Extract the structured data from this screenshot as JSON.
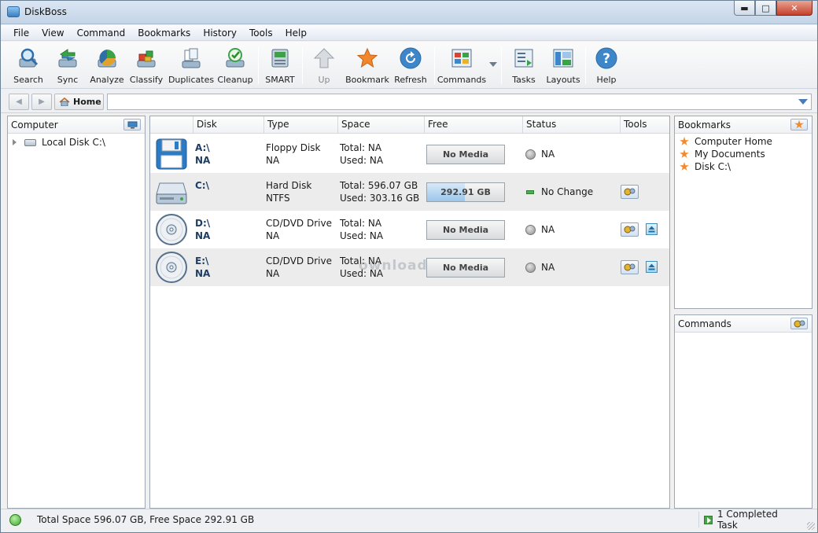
{
  "window": {
    "title": "DiskBoss",
    "minimize": "▬",
    "maximize": "□",
    "close": "✕"
  },
  "menu": [
    "File",
    "View",
    "Command",
    "Bookmarks",
    "History",
    "Tools",
    "Help"
  ],
  "toolbar": {
    "search": "Search",
    "sync": "Sync",
    "analyze": "Analyze",
    "classify": "Classify",
    "duplicates": "Duplicates",
    "cleanup": "Cleanup",
    "smart": "SMART",
    "up": "Up",
    "bookmark": "Bookmark",
    "refresh": "Refresh",
    "commands": "Commands",
    "tasks": "Tasks",
    "layouts": "Layouts",
    "help": "Help"
  },
  "nav": {
    "home_label": "Home",
    "address_value": ""
  },
  "left_panel": {
    "title": "Computer",
    "tree": [
      {
        "label": "Local Disk C:\\"
      }
    ]
  },
  "columns": {
    "disk": "Disk",
    "type": "Type",
    "space": "Space",
    "free": "Free",
    "status": "Status",
    "tools": "Tools"
  },
  "disks": [
    {
      "name": "A:\\",
      "label": "NA",
      "type": "Floppy Disk",
      "fs": "NA",
      "total": "Total: NA",
      "used": "Used: NA",
      "free": "No Media",
      "free_fraction": 0,
      "status": "NA",
      "icon": "floppy-icon"
    },
    {
      "name": "C:\\",
      "label": "",
      "type": "Hard Disk",
      "fs": "NTFS",
      "total": "Total: 596.07 GB",
      "used": "Used: 303.16 GB",
      "free": "292.91 GB",
      "free_fraction": 0.49,
      "status": "No Change",
      "icon": "hard-disk-icon"
    },
    {
      "name": "D:\\",
      "label": "NA",
      "type": "CD/DVD Drive",
      "fs": "NA",
      "total": "Total: NA",
      "used": "Used: NA",
      "free": "No Media",
      "free_fraction": 0,
      "status": "NA",
      "icon": "cd-icon"
    },
    {
      "name": "E:\\",
      "label": "NA",
      "type": "CD/DVD Drive",
      "fs": "NA",
      "total": "Total: NA",
      "used": "Used: NA",
      "free": "No Media",
      "free_fraction": 0,
      "status": "NA",
      "icon": "cd-icon"
    }
  ],
  "bookmarks": {
    "title": "Bookmarks",
    "items": [
      "Computer Home",
      "My Documents",
      "Disk C:\\"
    ]
  },
  "commands_panel": {
    "title": "Commands"
  },
  "status": {
    "space_text": "Total Space 596.07 GB, Free Space 292.91 GB",
    "tasks_text": "1 Completed Task"
  },
  "watermark": "ownload"
}
